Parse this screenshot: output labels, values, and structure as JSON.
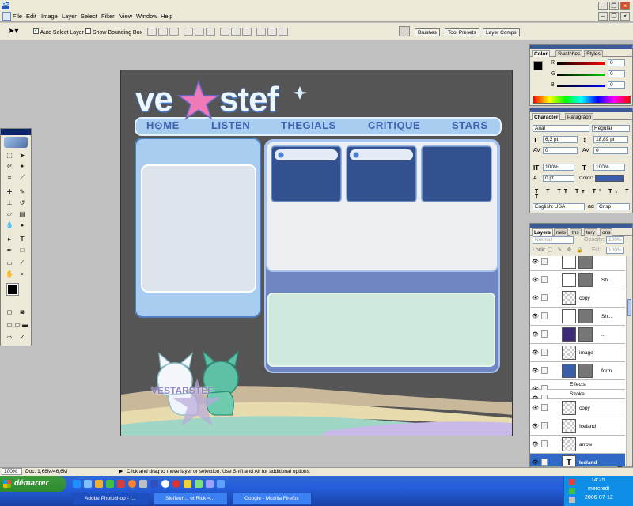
{
  "titlebar": {
    "app_icon": "Ps"
  },
  "menu": [
    "File",
    "Edit",
    "Image",
    "Layer",
    "Select",
    "Filter",
    "View",
    "Window",
    "Help"
  ],
  "options": {
    "auto_select_label": "Auto Select Layer",
    "auto_select_checked": true,
    "bounding_box_label": "Show Bounding Box",
    "bounding_box_checked": false
  },
  "well_tabs": [
    "Brushes",
    "Tool Presets",
    "Layer Comps"
  ],
  "color_panel": {
    "tabs": [
      "Color",
      "Swatches",
      "Styles"
    ],
    "channels": [
      {
        "label": "R",
        "value": "0"
      },
      {
        "label": "G",
        "value": "0"
      },
      {
        "label": "B",
        "value": "0"
      }
    ]
  },
  "character_panel": {
    "tabs": [
      "Character",
      "Paragraph"
    ],
    "font_family": "Arial",
    "font_style": "Regular",
    "size": "6,3 pt",
    "leading": "18,89 pt",
    "kerning": "0",
    "tracking": "0",
    "v_scale": "100%",
    "h_scale": "100%",
    "baseline": "0 pt",
    "color_label": "Color:",
    "color_value": "#3a5ea8",
    "language": "English: USA",
    "aa_label": "aɑ",
    "antialias": "Crisp"
  },
  "layers_panel": {
    "tabs": [
      "Layers",
      "nels",
      "ths",
      "tory",
      "ons"
    ],
    "blend_mode": "Normal",
    "opacity_label": "Opacity:",
    "opacity": "100%",
    "lock_label": "Lock:",
    "fill_label": "Fill:",
    "fill": "100%",
    "layers": [
      {
        "name": "",
        "thumb": "white",
        "mask": true
      },
      {
        "name": "Sh...",
        "thumb": "white",
        "mask": true
      },
      {
        "name": "copy",
        "thumb": "checker",
        "mask": false
      },
      {
        "name": "Sh...",
        "thumb": "white",
        "mask": true
      },
      {
        "name": "...",
        "thumb": "purple",
        "mask": true
      },
      {
        "name": "image",
        "thumb": "checker",
        "mask": false
      },
      {
        "name": "form",
        "thumb": "blue",
        "mask": true
      },
      {
        "name": "Effects",
        "thumb": "none",
        "mask": false
      },
      {
        "name": "Stroke",
        "thumb": "none",
        "mask": false
      },
      {
        "name": "copy",
        "thumb": "checker",
        "mask": false
      },
      {
        "name": "Iceland",
        "thumb": "checker",
        "mask": false
      },
      {
        "name": "arrow",
        "thumb": "checker",
        "mask": false
      },
      {
        "name": "Iceland",
        "thumb": "text",
        "mask": false
      }
    ]
  },
  "canvas": {
    "logo_left": "ve",
    "logo_right": "stef",
    "nav": [
      "H⊙ME",
      "LISTEN",
      "THEGIALS",
      "CRITIQUE",
      "STARS"
    ],
    "mascot_text": "VESTARSTEF"
  },
  "status": {
    "zoom": "100%",
    "doc": "Doc: 1,68M/46,6M",
    "hint": "Click and drag to move layer or selection.  Use Shift and Alt for additional options."
  },
  "taskbar": {
    "start": "démarrer",
    "tasks": [
      "Adobe Photoshop - [...",
      "Steffeuh... et Rick =...",
      "Google - Mozilla Firefox"
    ],
    "time": "14:25",
    "day": "mercredi",
    "date": "2006-07-12"
  }
}
